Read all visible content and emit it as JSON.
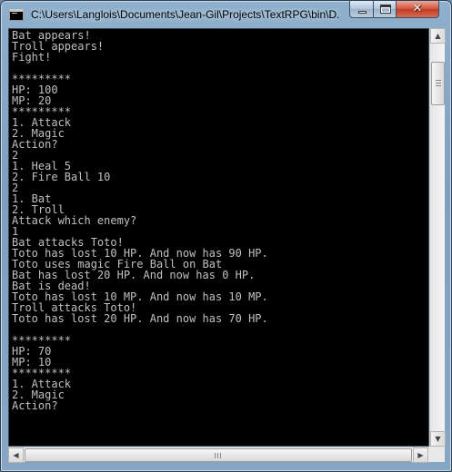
{
  "window": {
    "title": "C:\\Users\\Langlois\\Documents\\Jean-Gil\\Projects\\TextRPG\\bin\\D...",
    "icon": "console-app-icon",
    "controls": {
      "minimize_icon": "minimize-icon",
      "maximize_icon": "maximize-icon",
      "close_icon": "close-icon",
      "close_glyph": "✕"
    }
  },
  "console": {
    "lines": [
      "Bat appears!",
      "Troll appears!",
      "Fight!",
      "",
      "*********",
      "HP: 100",
      "MP: 20",
      "*********",
      "1. Attack",
      "2. Magic",
      "Action?",
      "2",
      "1. Heal 5",
      "2. Fire Ball 10",
      "2",
      "1. Bat",
      "2. Troll",
      "Attack which enemy?",
      "1",
      "Bat attacks Toto!",
      "Toto has lost 10 HP. And now has 90 HP.",
      "Toto uses magic Fire Ball on Bat",
      "Bat has lost 20 HP. And now has 0 HP.",
      "Bat is dead!",
      "Toto has lost 10 MP. And now has 10 MP.",
      "Troll attacks Toto!",
      "Toto has lost 20 HP. And now has 70 HP.",
      "",
      "*********",
      "HP: 70",
      "MP: 10",
      "*********",
      "1. Attack",
      "2. Magic",
      "Action?"
    ],
    "colors": {
      "background": "#000000",
      "foreground": "#c0c0c0"
    }
  },
  "scrollbars": {
    "vertical": {
      "up_glyph": "▲",
      "down_glyph": "▼"
    },
    "horizontal": {
      "left_glyph": "◀",
      "right_glyph": "▶"
    }
  }
}
